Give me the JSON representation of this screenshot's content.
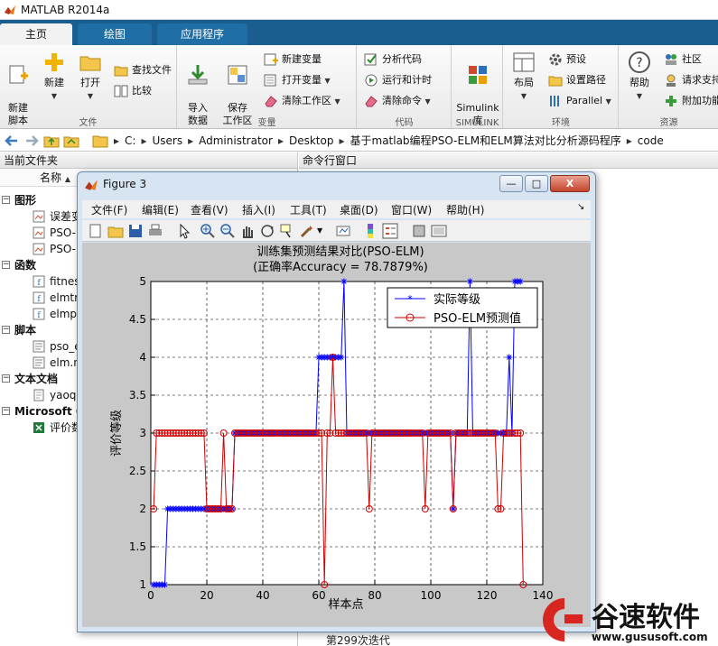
{
  "app": {
    "title": "MATLAB R2014a"
  },
  "tabs": [
    {
      "label": "主页",
      "active": true
    },
    {
      "label": "绘图",
      "active": false
    },
    {
      "label": "应用程序",
      "active": false
    }
  ],
  "toolstrip": {
    "file": {
      "title": "文件",
      "new_script": "新建\n脚本",
      "new": "新建",
      "open": "打开",
      "find_files": "查找文件",
      "compare": "比较"
    },
    "variable": {
      "title": "变量",
      "import_data": "导入\n数据",
      "save_workspace": "保存\n工作区",
      "new_variable": "新建变量",
      "open_variable": "打开变量",
      "clear_workspace": "清除工作区"
    },
    "code": {
      "title": "代码",
      "analyze_code": "分析代码",
      "run_and_time": "运行和计时",
      "clear_commands": "清除命令"
    },
    "simulink": {
      "title": "SIMULINK",
      "library": "Simulink\n库"
    },
    "environment": {
      "title": "环境",
      "layout": "布局",
      "preferences": "预设",
      "set_path": "设置路径",
      "parallel": "Parallel"
    },
    "resources": {
      "title": "资源",
      "help": "帮助",
      "community": "社区",
      "request_support": "请求支持",
      "add_ons": "附加功能"
    }
  },
  "address": {
    "crumbs": [
      "C:",
      "Users",
      "Administrator",
      "Desktop",
      "基于matlab编程PSO-ELM和ELM算法对比分析源码程序",
      "code"
    ]
  },
  "left_panel": {
    "title": "当前文件夹",
    "column_name": "名称",
    "groups": [
      {
        "label": "图形",
        "files": [
          "误差变",
          "PSO-",
          "PSO-"
        ]
      },
      {
        "label": "函数",
        "files": [
          "fitnes",
          "elmtr",
          "elmp"
        ]
      },
      {
        "label": "脚本",
        "files": [
          "pso_e",
          "elm.n"
        ]
      },
      {
        "label": "文本文档",
        "files": [
          "yaoq"
        ]
      },
      {
        "label": "Microsoft O",
        "files": [
          "评价数"
        ]
      }
    ]
  },
  "right_panel": {
    "title": "命令行窗口",
    "lines": [
      "第299次迭代"
    ]
  },
  "figure": {
    "title": "Figure 3",
    "menu": [
      "文件(F)",
      "编辑(E)",
      "查看(V)",
      "插入(I)",
      "工具(T)",
      "桌面(D)",
      "窗口(W)",
      "帮助(H)"
    ],
    "window_buttons": {
      "minimize": "—",
      "maximize": "□",
      "close": "X"
    }
  },
  "chart_data": {
    "type": "line",
    "title": "训练集预测结果对比(PSO-ELM)",
    "subtitle": "(正确率Accuracy = 78.7879%)",
    "xlabel": "样本点",
    "ylabel": "评价等级",
    "xlim": [
      0,
      140
    ],
    "ylim": [
      1,
      5
    ],
    "xticks": [
      0,
      20,
      40,
      60,
      80,
      100,
      120,
      140
    ],
    "yticks": [
      1,
      1.5,
      2,
      2.5,
      3,
      3.5,
      4,
      4.5,
      5
    ],
    "grid": true,
    "legend_position": "top-right",
    "series": [
      {
        "name": "实际等级",
        "color": "#0000ff",
        "marker": "star",
        "values": [
          1,
          1,
          1,
          1,
          1,
          2,
          2,
          2,
          2,
          2,
          2,
          2,
          2,
          2,
          2,
          2,
          2,
          2,
          2,
          2,
          2,
          2,
          2,
          2,
          2,
          2,
          2,
          2,
          2,
          3,
          3,
          3,
          3,
          3,
          3,
          3,
          3,
          3,
          3,
          3,
          3,
          3,
          3,
          3,
          3,
          3,
          3,
          3,
          3,
          3,
          3,
          3,
          3,
          3,
          3,
          3,
          3,
          3,
          3,
          4,
          4,
          4,
          4,
          4,
          4,
          4,
          4,
          4,
          5,
          3,
          3,
          3,
          3,
          3,
          3,
          3,
          3,
          3,
          3,
          3,
          3,
          3,
          3,
          3,
          3,
          3,
          3,
          3,
          3,
          3,
          3,
          3,
          3,
          3,
          3,
          3,
          3,
          3,
          3,
          3,
          3,
          3,
          3,
          3,
          3,
          3,
          3,
          2,
          3,
          3,
          3,
          3,
          3,
          5,
          3,
          3,
          3,
          3,
          3,
          3,
          3,
          3,
          3,
          3,
          3,
          3,
          3,
          4,
          3,
          5,
          5,
          5
        ]
      },
      {
        "name": "PSO-ELM预测值",
        "color": "#cc0000",
        "marker": "circle",
        "values": [
          2,
          3,
          3,
          3,
          3,
          3,
          3,
          3,
          3,
          3,
          3,
          3,
          3,
          3,
          3,
          3,
          3,
          3,
          3,
          2,
          2,
          2,
          2,
          2,
          2,
          3,
          2,
          2,
          2,
          3,
          3,
          3,
          3,
          3,
          3,
          3,
          3,
          3,
          3,
          3,
          3,
          3,
          3,
          3,
          3,
          3,
          3,
          3,
          3,
          3,
          3,
          3,
          3,
          3,
          3,
          3,
          3,
          3,
          3,
          3,
          3,
          1,
          3,
          3,
          4,
          3,
          3,
          3,
          3,
          3,
          3,
          3,
          3,
          3,
          3,
          3,
          3,
          2,
          3,
          3,
          3,
          3,
          3,
          3,
          3,
          3,
          3,
          3,
          3,
          3,
          3,
          3,
          3,
          3,
          3,
          3,
          3,
          2,
          3,
          3,
          3,
          3,
          3,
          3,
          3,
          3,
          3,
          2,
          3,
          3,
          3,
          3,
          3,
          3,
          3,
          3,
          3,
          3,
          3,
          3,
          3,
          3,
          3,
          2,
          2,
          3,
          3,
          3,
          3,
          3,
          3,
          3,
          1
        ]
      }
    ]
  },
  "watermark": {
    "brand": "谷速软件",
    "url": "www.gususoft.com"
  }
}
